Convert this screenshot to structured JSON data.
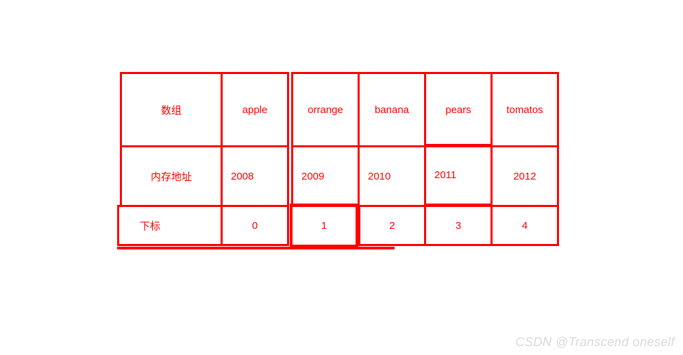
{
  "chart_data": {
    "type": "table",
    "rows": [
      {
        "label": "数组",
        "values": [
          "apple",
          "orrange",
          "banana",
          "pears",
          "tomatos"
        ]
      },
      {
        "label": "内存地址",
        "values": [
          "2008",
          "2009",
          "2010",
          "2011",
          "2012"
        ]
      },
      {
        "label": "下标",
        "values": [
          "0",
          "1",
          "2",
          "3",
          "4"
        ]
      }
    ]
  },
  "watermark": "CSDN @Transcend oneself"
}
